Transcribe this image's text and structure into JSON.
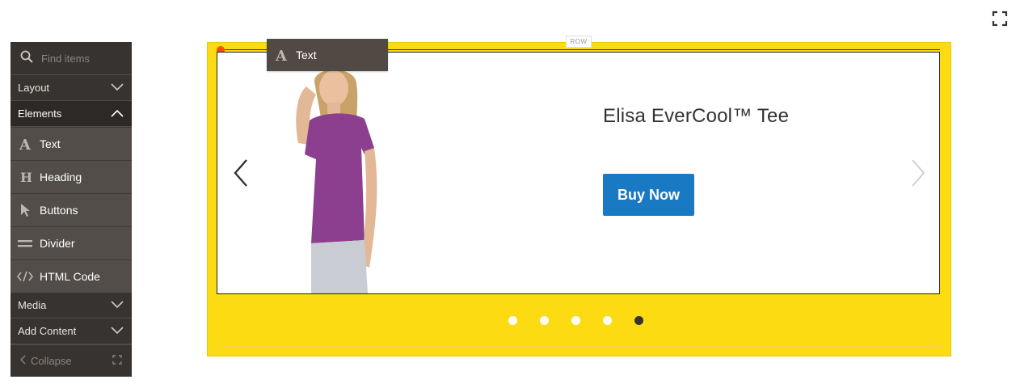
{
  "search": {
    "placeholder": "Find items"
  },
  "sections": {
    "layout": "Layout",
    "elements": "Elements",
    "media": "Media",
    "add_content": "Add Content"
  },
  "elements_items": [
    {
      "label": "Text",
      "icon": "text-icon"
    },
    {
      "label": "Heading",
      "icon": "heading-icon"
    },
    {
      "label": "Buttons",
      "icon": "cursor-icon"
    },
    {
      "label": "Divider",
      "icon": "divider-icon"
    },
    {
      "label": "HTML Code",
      "icon": "code-icon"
    }
  ],
  "collapse_label": "Collapse",
  "stage": {
    "row_tag": "ROW",
    "drag_tooltip": "Text",
    "slide": {
      "title": "Elisa EverCool™ Tee",
      "button": "Buy Now"
    },
    "dots": {
      "count": 5,
      "active_index": 4
    }
  },
  "colors": {
    "panel_bg": "#373330",
    "row_bg": "#fddb13",
    "button_bg": "#1979c3",
    "accent_dot": "#eb5202"
  }
}
